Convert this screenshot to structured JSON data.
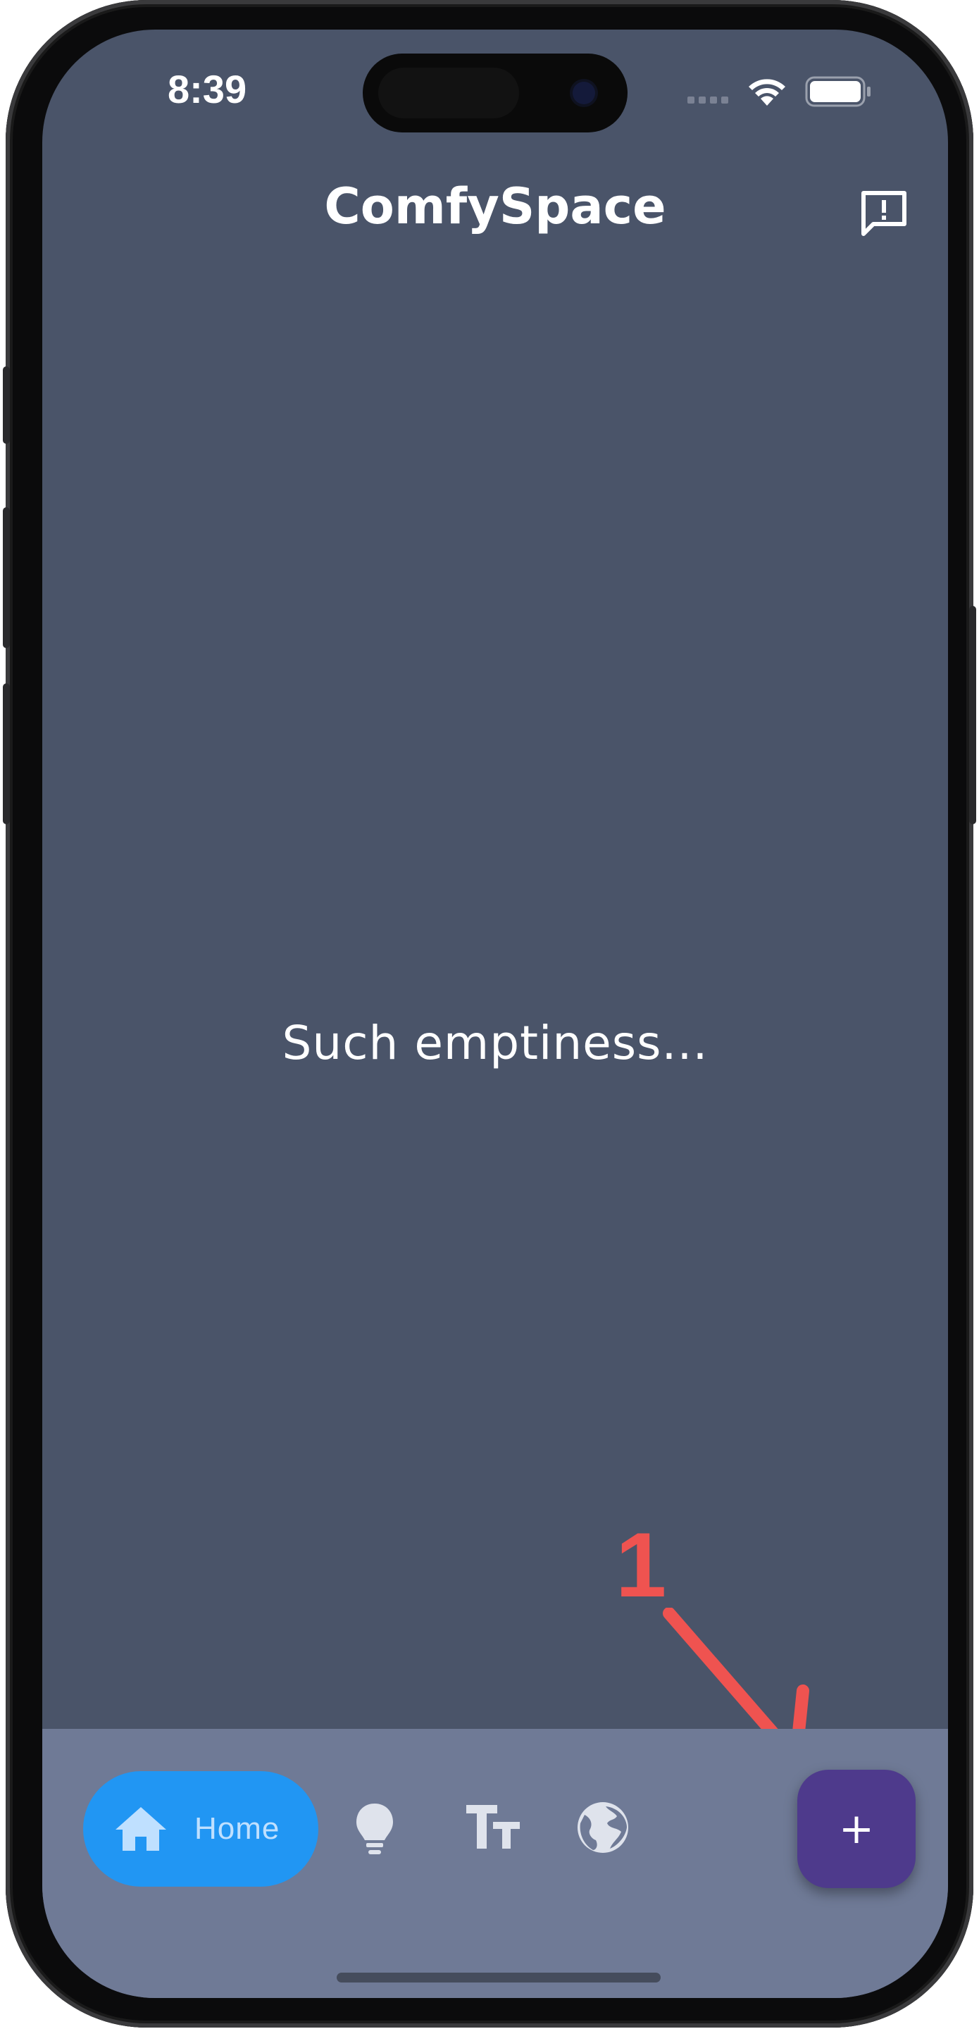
{
  "status_bar": {
    "time": "8:39"
  },
  "header": {
    "title": "ComfySpace",
    "feedback_icon": "feedback-icon"
  },
  "main": {
    "empty_message": "Such emptiness..."
  },
  "annotation": {
    "number": "1",
    "color": "#ef5350"
  },
  "bottom_nav": {
    "items": [
      {
        "label": "Home",
        "icon": "home-icon",
        "selected": true
      },
      {
        "label": "",
        "icon": "lightbulb-icon",
        "selected": false
      },
      {
        "label": "",
        "icon": "text-size-icon",
        "selected": false
      },
      {
        "label": "",
        "icon": "globe-icon",
        "selected": false
      }
    ],
    "fab_label": "+"
  },
  "colors": {
    "background": "#4a5469",
    "bottom_bar": "#6f7a96",
    "accent": "#2196f3",
    "fab": "#4e3a8c"
  }
}
